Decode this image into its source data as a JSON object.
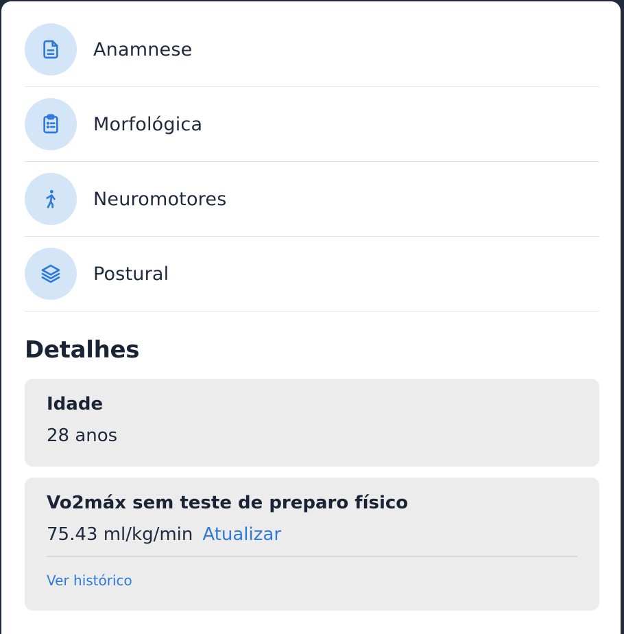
{
  "menu": {
    "items": [
      {
        "label": "Anamnese",
        "icon": "document-icon"
      },
      {
        "label": "Morfológica",
        "icon": "clipboard-list-icon"
      },
      {
        "label": "Neuromotores",
        "icon": "walking-person-icon"
      },
      {
        "label": "Postural",
        "icon": "layers-icon"
      }
    ]
  },
  "details": {
    "title": "Detalhes",
    "age": {
      "label": "Idade",
      "value": "28 anos"
    },
    "vo2": {
      "label": "Vo2máx sem teste de preparo físico",
      "value": "75.43 ml/kg/min",
      "update_label": "Atualizar",
      "history_label": "Ver histórico"
    }
  },
  "colors": {
    "accent": "#2f7ad9",
    "icon_bg": "#d5e5f8",
    "card_bg": "#ececed",
    "text": "#1f2a3d"
  }
}
